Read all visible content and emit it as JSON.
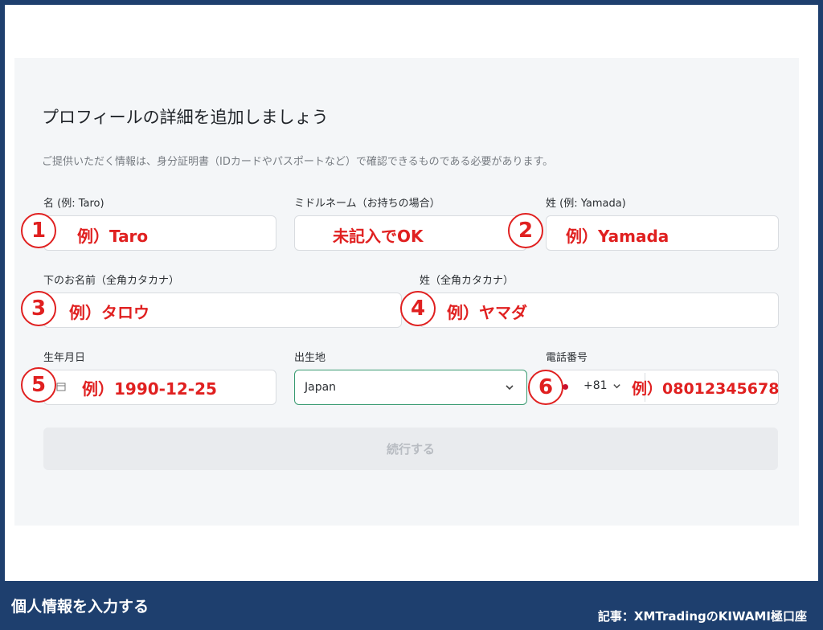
{
  "form": {
    "title": "プロフィールの詳細を追加しましょう",
    "description": "ご提供いただく情報は、身分証明書（IDカードやパスポートなど）で確認できるものである必要があります。",
    "first_name_label": "名 (例: Taro)",
    "middle_name_label": "ミドルネーム（お持ちの場合）",
    "last_name_label": "姓 (例: Yamada)",
    "first_name_kana_label": "下のお名前（全角カタカナ）",
    "last_name_kana_label": "姓（全角カタカナ）",
    "birthdate_label": "生年月日",
    "birthplace_label": "出生地",
    "birthplace_value": "Japan",
    "phone_label": "電話番号",
    "phone_country_code": "+81",
    "continue_label": "続行する"
  },
  "annotations": {
    "markers": [
      "1",
      "2",
      "3",
      "4",
      "5",
      "6"
    ],
    "first_name_example": "例）Taro",
    "middle_name_note": "未記入でOK",
    "last_name_example": "例）Yamada",
    "first_name_kana_example": "例）タロウ",
    "last_name_kana_example": "例）ヤマダ",
    "birthdate_example": "例）1990-12-25",
    "phone_example": "例）08012345678"
  },
  "caption": {
    "left": "個人情報を入力する",
    "right": "記事：XMTradingのKIWAMI極口座"
  },
  "colors": {
    "annotation_red": "#e02020",
    "frame_navy": "#1e3f6e",
    "select_border_green": "#3a9b72"
  }
}
